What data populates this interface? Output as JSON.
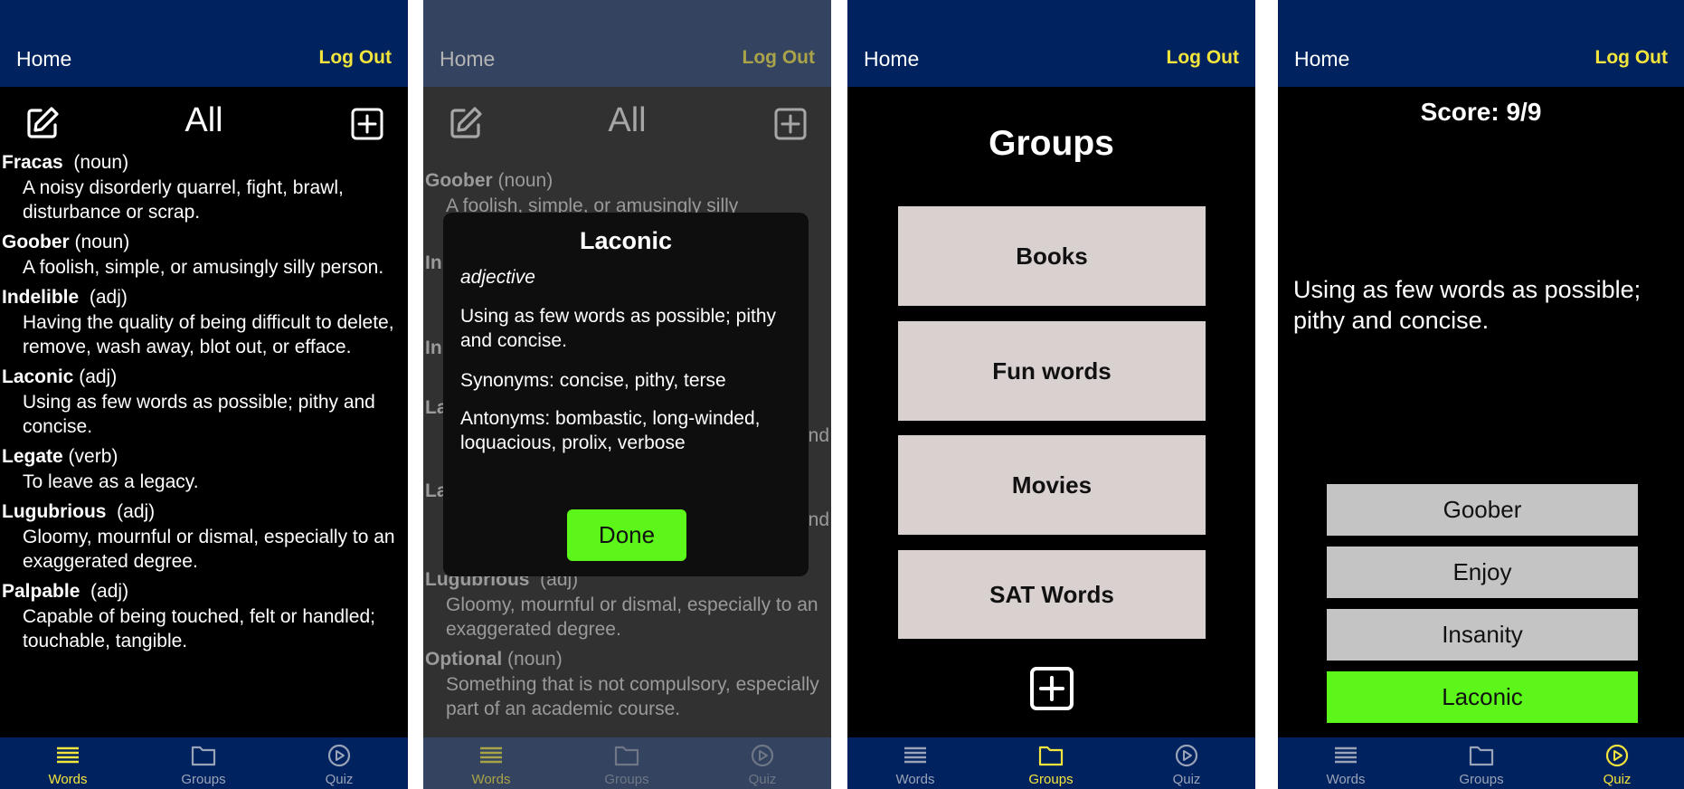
{
  "header": {
    "home": "Home",
    "logout": "Log Out"
  },
  "nav": {
    "words": "Words",
    "groups": "Groups",
    "quiz": "Quiz"
  },
  "words_screen": {
    "title": "All",
    "entries": [
      {
        "word": "Fracas",
        "pos": "(noun)",
        "def": "A noisy disorderly quarrel, fight, brawl, disturbance or scrap."
      },
      {
        "word": "Goober",
        "pos": "(noun)",
        "def": "A foolish, simple, or amusingly silly person."
      },
      {
        "word": "Indelible",
        "pos": "(adj)",
        "def": "Having the quality of being difficult to delete, remove, wash away, blot out, or efface."
      },
      {
        "word": "Laconic",
        "pos": "(adj)",
        "def": "Using as few words as possible; pithy and concise."
      },
      {
        "word": "Legate",
        "pos": "(verb)",
        "def": "To leave as a legacy."
      },
      {
        "word": "Lugubrious",
        "pos": "(adj)",
        "def": "Gloomy, mournful or dismal, especially to an exaggerated degree."
      },
      {
        "word": "Palpable",
        "pos": "(adj)",
        "def": "Capable of being touched, felt or handled; touchable, tangible."
      }
    ]
  },
  "dim_screen": {
    "title": "All",
    "entries": [
      {
        "word": "Goober",
        "pos": "(noun)",
        "def": "A foolish, simple, or amusingly silly"
      },
      {
        "word": "Lugubrious",
        "pos": "(adj)",
        "def": "Gloomy, mournful or dismal, especially to an exaggerated degree."
      },
      {
        "word": "Optional",
        "pos": "(noun)",
        "def": "Something that is not compulsory, especially part of an academic course."
      }
    ],
    "peek_in1": "In",
    "peek_in2": "In",
    "peek_la1": "La",
    "peek_la2": "La",
    "peek_nd1": "nd",
    "peek_nd2": "nd"
  },
  "dialog": {
    "title": "Laconic",
    "pos": "adjective",
    "definition": "Using as few words as possible; pithy and concise.",
    "synonyms": "Synonyms: concise, pithy, terse",
    "antonyms": "Antonyms: bombastic, long-winded, loquacious, prolix, verbose",
    "done": "Done"
  },
  "groups_screen": {
    "title": "Groups",
    "groups": [
      "Books",
      "Fun words",
      "Movies",
      "SAT Words"
    ]
  },
  "quiz_screen": {
    "score": "Score: 9/9",
    "question": "Using as few words as possible; pithy and concise.",
    "answers": [
      "Goober",
      "Enjoy",
      "Insanity",
      "Laconic"
    ]
  },
  "colors": {
    "bar": "#00235f",
    "accent_yellow": "#f4e53c",
    "correct_green": "#5cf61a",
    "group_button": "#d9d0d0",
    "answer_button": "#c4c4c4"
  }
}
